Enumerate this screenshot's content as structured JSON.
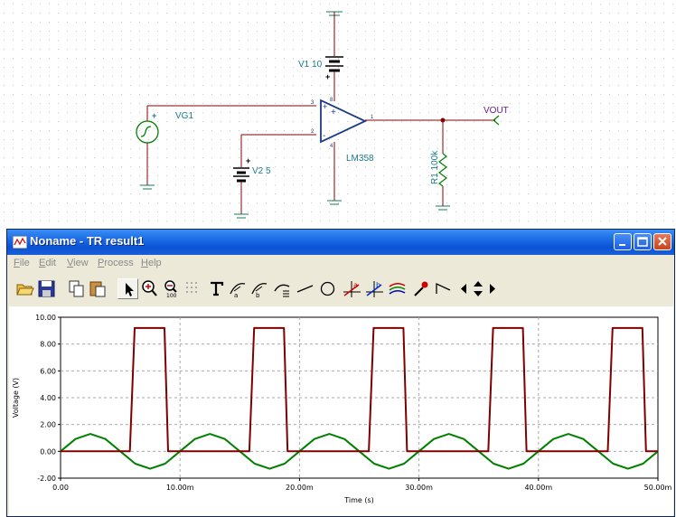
{
  "schematic": {
    "labels": {
      "v1": "V1 10",
      "vg1": "VG1",
      "v2": "V2 5",
      "opamp": "LM358",
      "r1": "R1 100k",
      "vout": "VOUT"
    },
    "pins": {
      "p3": "3",
      "p2": "2",
      "p1": "1",
      "p8": "8",
      "p4": "4"
    },
    "plus": "+",
    "minus": "-"
  },
  "window": {
    "title": "Noname - TR result1",
    "menu": [
      "File",
      "Edit",
      "View",
      "Process",
      "Help"
    ]
  },
  "toolbar": {
    "icons": [
      "open-folder-icon",
      "save-icon",
      "copy-icon",
      "paste-icon",
      "pointer-icon",
      "zoom-in-icon",
      "zoom-100-icon",
      "grid-icon",
      "text-icon",
      "curve-label-icon",
      "curve-label2-icon",
      "header-icon",
      "line-icon",
      "circle-icon",
      "cursor-a-icon",
      "cursor-b-icon",
      "multi-curve-icon",
      "eyedropper-icon",
      "step-icon",
      "left-arrow-icon",
      "up-down-arrow-icon",
      "right-arrow-icon"
    ]
  },
  "colors": {
    "square": "#800000",
    "sine": "#008000",
    "accent": "#0a52d6"
  },
  "chart_data": {
    "type": "line",
    "xlabel": "Time (s)",
    "ylabel": "Voltage (V)",
    "xlim": [
      0,
      0.05
    ],
    "ylim": [
      -2,
      10
    ],
    "xticks": [
      0,
      0.01,
      0.02,
      0.03,
      0.04,
      0.05
    ],
    "xtick_labels": [
      "0.00",
      "10.00m",
      "20.00m",
      "30.00m",
      "40.00m",
      "50.00m"
    ],
    "yticks": [
      -2,
      0,
      2,
      4,
      6,
      8,
      10
    ],
    "ytick_labels": [
      "-2.00",
      "0.00",
      "2.00",
      "4.00",
      "6.00",
      "8.00",
      "10.00"
    ],
    "grid": true,
    "series": [
      {
        "color": "#008000",
        "x": [
          0,
          0.00125,
          0.0025,
          0.00375,
          0.005,
          0.00625,
          0.0075,
          0.00875,
          0.01,
          0.01125,
          0.0125,
          0.01375,
          0.015,
          0.01625,
          0.0175,
          0.01875,
          0.02,
          0.02125,
          0.0225,
          0.02375,
          0.025,
          0.02625,
          0.0275,
          0.02875,
          0.03,
          0.03125,
          0.0325,
          0.03375,
          0.035,
          0.03625,
          0.0375,
          0.03875,
          0.04,
          0.04125,
          0.0425,
          0.04375,
          0.045,
          0.04625,
          0.0475,
          0.04875,
          0.05
        ],
        "y": [
          0,
          0.92,
          1.3,
          0.92,
          0,
          -0.92,
          -1.3,
          -0.92,
          0,
          0.92,
          1.3,
          0.92,
          0,
          -0.92,
          -1.3,
          -0.92,
          0,
          0.92,
          1.3,
          0.92,
          0,
          -0.92,
          -1.3,
          -0.92,
          0,
          0.92,
          1.3,
          0.92,
          0,
          -0.92,
          -1.3,
          -0.92,
          0,
          0.92,
          1.3,
          0.92,
          0,
          -0.92,
          -1.3,
          -0.92,
          0
        ]
      },
      {
        "color": "#800000",
        "x": [
          0,
          0.0058,
          0.0062,
          0.0087,
          0.009,
          0.0158,
          0.0162,
          0.0187,
          0.019,
          0.0258,
          0.0262,
          0.0287,
          0.029,
          0.0358,
          0.0362,
          0.0387,
          0.039,
          0.0458,
          0.0462,
          0.0487,
          0.049,
          0.05
        ],
        "y": [
          0,
          0,
          9.2,
          9.2,
          0,
          0,
          9.2,
          9.2,
          0,
          0,
          9.2,
          9.2,
          0,
          0,
          9.2,
          9.2,
          0,
          0,
          9.2,
          9.2,
          0,
          0
        ]
      }
    ]
  }
}
